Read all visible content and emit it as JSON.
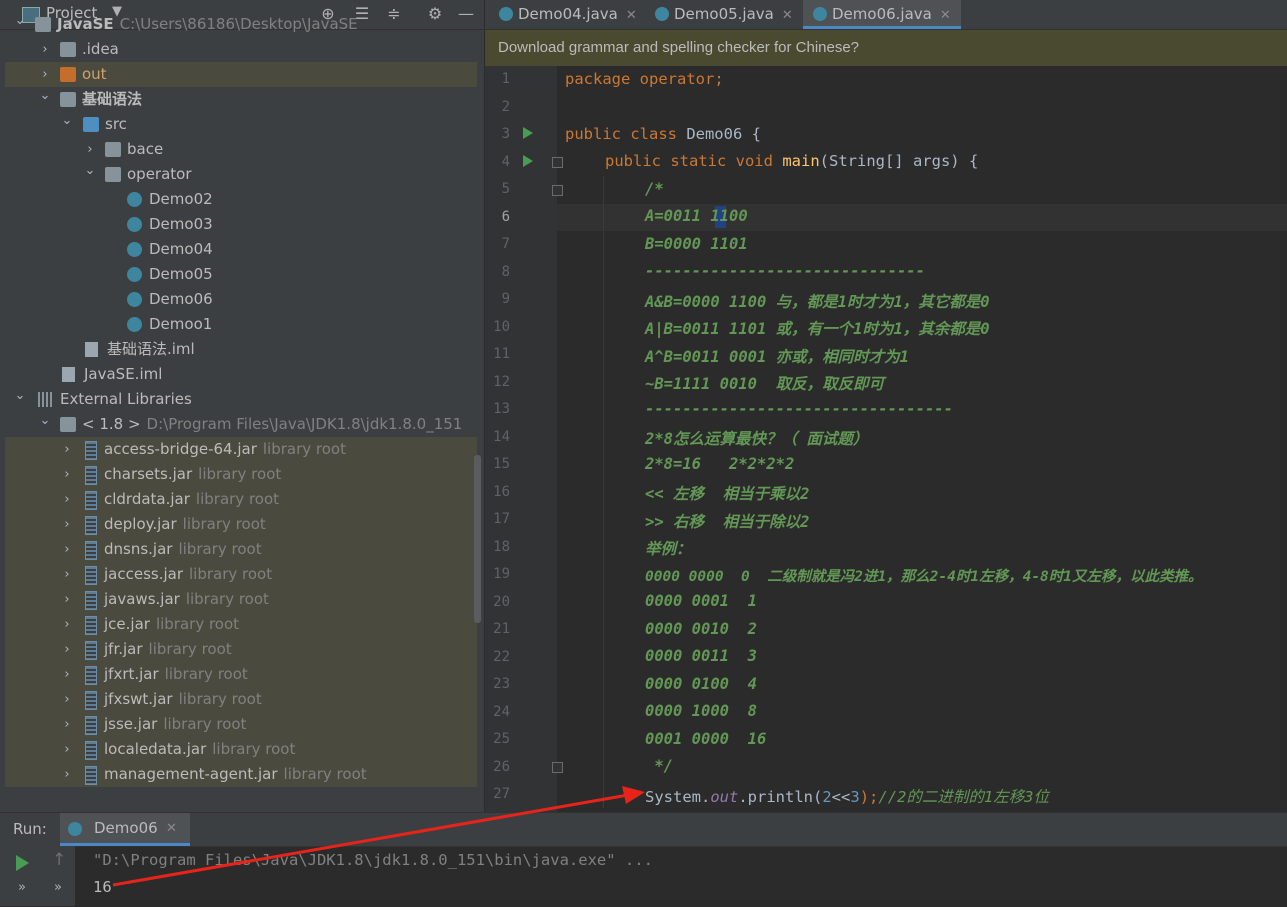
{
  "project_panel": {
    "title": "Project",
    "tree": [
      {
        "label": "JavaSE",
        "sub": "C:\\Users\\86186\\Desktop\\JavaSE",
        "bold": true
      },
      {
        "label": ".idea"
      },
      {
        "label": "out"
      },
      {
        "label": "基础语法",
        "bold": true
      },
      {
        "label": "src"
      },
      {
        "label": "bace"
      },
      {
        "label": "operator"
      },
      {
        "label": "Demo02"
      },
      {
        "label": "Demo03"
      },
      {
        "label": "Demo04"
      },
      {
        "label": "Demo05"
      },
      {
        "label": "Demo06"
      },
      {
        "label": "Demoo1"
      },
      {
        "label": "基础语法.iml"
      },
      {
        "label": "JavaSE.iml"
      },
      {
        "label": "External Libraries"
      },
      {
        "label": "< 1.8 >",
        "sub": "D:\\Program Files\\Java\\JDK1.8\\jdk1.8.0_151"
      },
      {
        "label": "access-bridge-64.jar",
        "sub": "library root"
      },
      {
        "label": "charsets.jar",
        "sub": "library root"
      },
      {
        "label": "cldrdata.jar",
        "sub": "library root"
      },
      {
        "label": "deploy.jar",
        "sub": "library root"
      },
      {
        "label": "dnsns.jar",
        "sub": "library root"
      },
      {
        "label": "jaccess.jar",
        "sub": "library root"
      },
      {
        "label": "javaws.jar",
        "sub": "library root"
      },
      {
        "label": "jce.jar",
        "sub": "library root"
      },
      {
        "label": "jfr.jar",
        "sub": "library root"
      },
      {
        "label": "jfxrt.jar",
        "sub": "library root"
      },
      {
        "label": "jfxswt.jar",
        "sub": "library root"
      },
      {
        "label": "jsse.jar",
        "sub": "library root"
      },
      {
        "label": "localedata.jar",
        "sub": "library root"
      },
      {
        "label": "management-agent.jar",
        "sub": "library root"
      }
    ]
  },
  "editor": {
    "tabs": [
      {
        "label": "Demo04.java"
      },
      {
        "label": "Demo05.java"
      },
      {
        "label": "Demo06.java",
        "active": true
      }
    ],
    "banner": "Download grammar and spelling checker for Chinese?",
    "code": {
      "l1a": "package",
      "l1b": " operator;",
      "l3a": "public class",
      "l3b": " Demo06 {",
      "l4a": "public static void",
      "l4b": "main",
      "l4c": "(String[] args) {",
      "l5": "/*",
      "l6a": "A=0011 ",
      "l6b": "1",
      "l6c": "100",
      "l7": "B=0000 1101",
      "l8": "------------------------------",
      "l9": "A&B=0000 1100 与，都是1时才为1，其它都是0",
      "l10": "A|B=0011 1101 或，有一个1时为1，其余都是0",
      "l11": "A^B=0011 0001 亦或，相同时才为1",
      "l12": "~B=1111 0010  取反，取反即可",
      "l13": "---------------------------------",
      "l14": "2*8怎么运算最快？（ 面试题）",
      "l15": "2*8=16   2*2*2*2",
      "l16": "<< 左移  相当于乘以2",
      "l17": ">> 右移  相当于除以2",
      "l18": "举例：",
      "l19": "0000 0000  0  二级制就是冯2进1，那么2-4时1左移，4-8时1又左移，以此类推。",
      "l20": "0000 0001  1",
      "l21": "0000 0010  2",
      "l22": "0000 0011  3",
      "l23": "0000 0100  4",
      "l24": "0000 1000  8",
      "l25": "0001 0000  16",
      "l26": " */",
      "l27a": "System.",
      "l27b": "out",
      "l27c": ".println(",
      "l27d": "2",
      "l27e": "<<",
      "l27f": "3",
      "l27g": ");",
      "l27h": "//2的二进制的1左移3位"
    },
    "line_numbers": [
      "1",
      "2",
      "3",
      "4",
      "5",
      "6",
      "7",
      "8",
      "9",
      "10",
      "11",
      "12",
      "13",
      "14",
      "15",
      "16",
      "17",
      "18",
      "19",
      "20",
      "21",
      "22",
      "23",
      "24",
      "25",
      "26",
      "27"
    ]
  },
  "run_panel": {
    "label": "Run:",
    "tab": "Demo06",
    "command": "\"D:\\Program Files\\Java\\JDK1.8\\jdk1.8.0_151\\bin\\java.exe\" ...",
    "output": "16"
  },
  "colors": {
    "annotation_arrow": "#e8241a",
    "keyword": "#cc7832",
    "comment": "#629755"
  }
}
